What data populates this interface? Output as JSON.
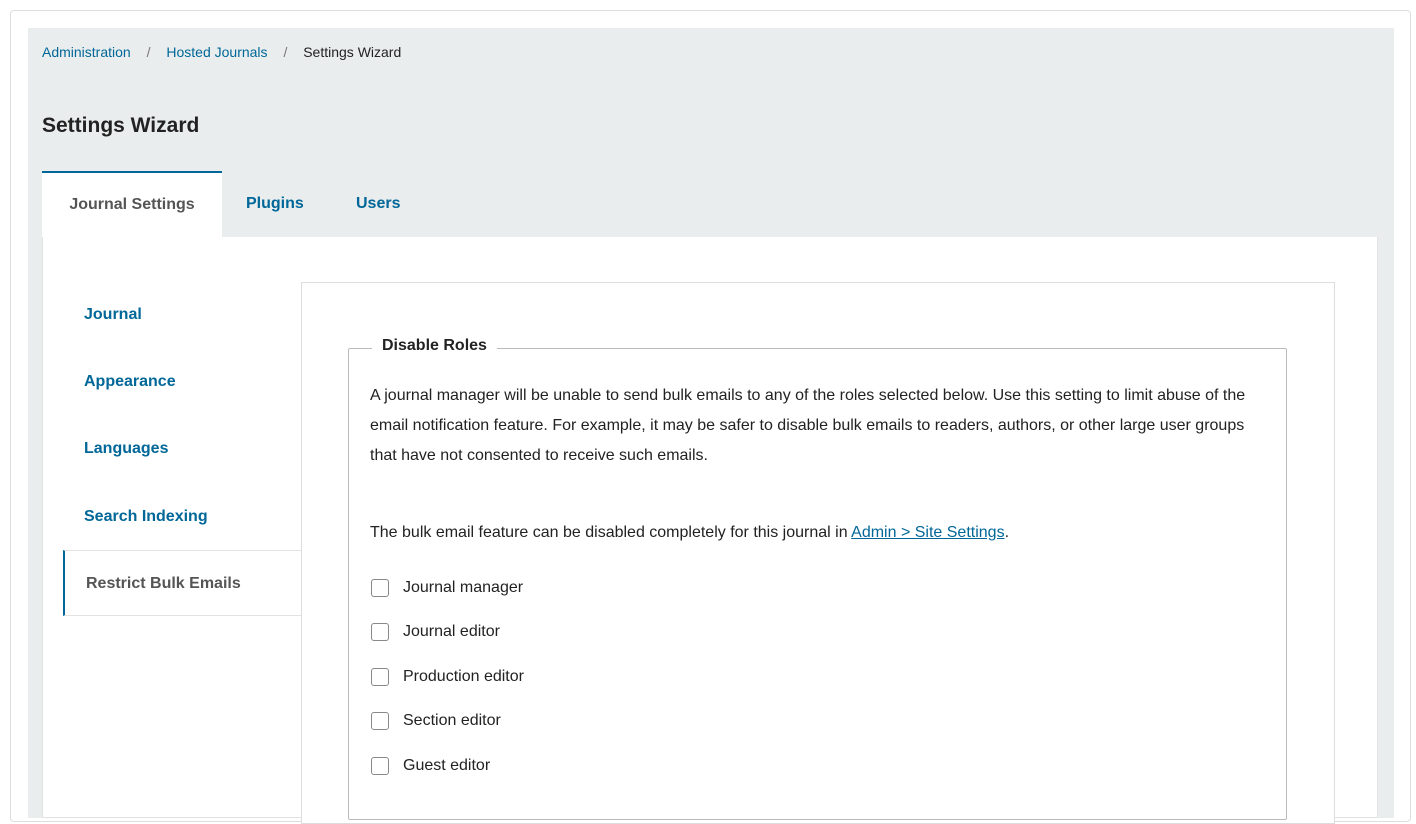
{
  "breadcrumb": {
    "items": [
      "Administration",
      "Hosted Journals",
      "Settings Wizard"
    ],
    "separator": "/"
  },
  "page": {
    "title": "Settings Wizard"
  },
  "tabs": [
    {
      "label": "Journal Settings",
      "active": true
    },
    {
      "label": "Plugins",
      "active": false
    },
    {
      "label": "Users",
      "active": false
    }
  ],
  "side_nav": [
    {
      "label": "Journal"
    },
    {
      "label": "Appearance"
    },
    {
      "label": "Languages"
    },
    {
      "label": "Search Indexing"
    },
    {
      "label": "Restrict Bulk Emails",
      "active": true
    }
  ],
  "disable_roles": {
    "legend": "Disable Roles",
    "description": "A journal manager will be unable to send bulk emails to any of the roles selected below. Use this setting to limit abuse of the email notification feature. For example, it may be safer to disable bulk emails to readers, authors, or other large user groups that have not consented to receive such emails.",
    "note_prefix": "The bulk email feature can be disabled completely for this journal in ",
    "note_link": "Admin > Site Settings",
    "note_suffix": ".",
    "roles": [
      {
        "label": "Journal manager",
        "checked": false
      },
      {
        "label": "Journal editor",
        "checked": false
      },
      {
        "label": "Production editor",
        "checked": false
      },
      {
        "label": "Section editor",
        "checked": false
      },
      {
        "label": "Guest editor",
        "checked": false
      }
    ]
  },
  "colors": {
    "accent": "#006798",
    "header_bg": "#eaedee"
  }
}
